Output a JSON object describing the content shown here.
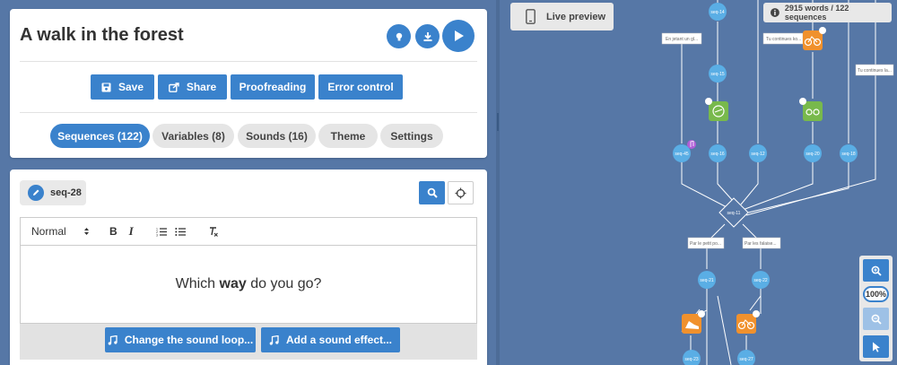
{
  "story": {
    "title": "A walk in the forest"
  },
  "header_actions": {
    "hint": "lightbulb-icon",
    "download": "download-icon",
    "play": "play-icon"
  },
  "toolbar": {
    "save": "Save",
    "share": "Share",
    "proofreading": "Proofreading",
    "error_control": "Error control"
  },
  "tabs": [
    {
      "label": "Sequences (122)",
      "active": true
    },
    {
      "label": "Variables (8)",
      "active": false
    },
    {
      "label": "Sounds (16)",
      "active": false
    },
    {
      "label": "Theme",
      "active": false
    },
    {
      "label": "Settings",
      "active": false
    }
  ],
  "editor": {
    "sequence_name": "seq-28",
    "format_select": "Normal",
    "content_before": "Which ",
    "content_bold": "way",
    "content_after": " do you go?",
    "change_sound_loop": "Change the sound loop...",
    "add_sound_effect": "Add a sound effect..."
  },
  "preview": {
    "live_preview": "Live preview",
    "stats": "2915 words / 122 sequences",
    "zoom_level": "100%"
  },
  "graph": {
    "choice_labels": [
      "En jetant un gl...",
      "Tu continues ko...",
      "Tu continues la...",
      "Par le petit po...",
      "Par les falaise..."
    ],
    "nodes": [
      "seq-14",
      "seq-15",
      "seq-45",
      "seq-16",
      "seq-12",
      "seq-20",
      "seq-18",
      "seq-11",
      "seq-21",
      "seq-22",
      "seq-23",
      "seq-27"
    ]
  },
  "colors": {
    "accent": "#3a82cc",
    "background": "#5677a6",
    "node": "#5aaee5",
    "green_tile": "#78b94c",
    "orange_tile": "#f0912d"
  }
}
